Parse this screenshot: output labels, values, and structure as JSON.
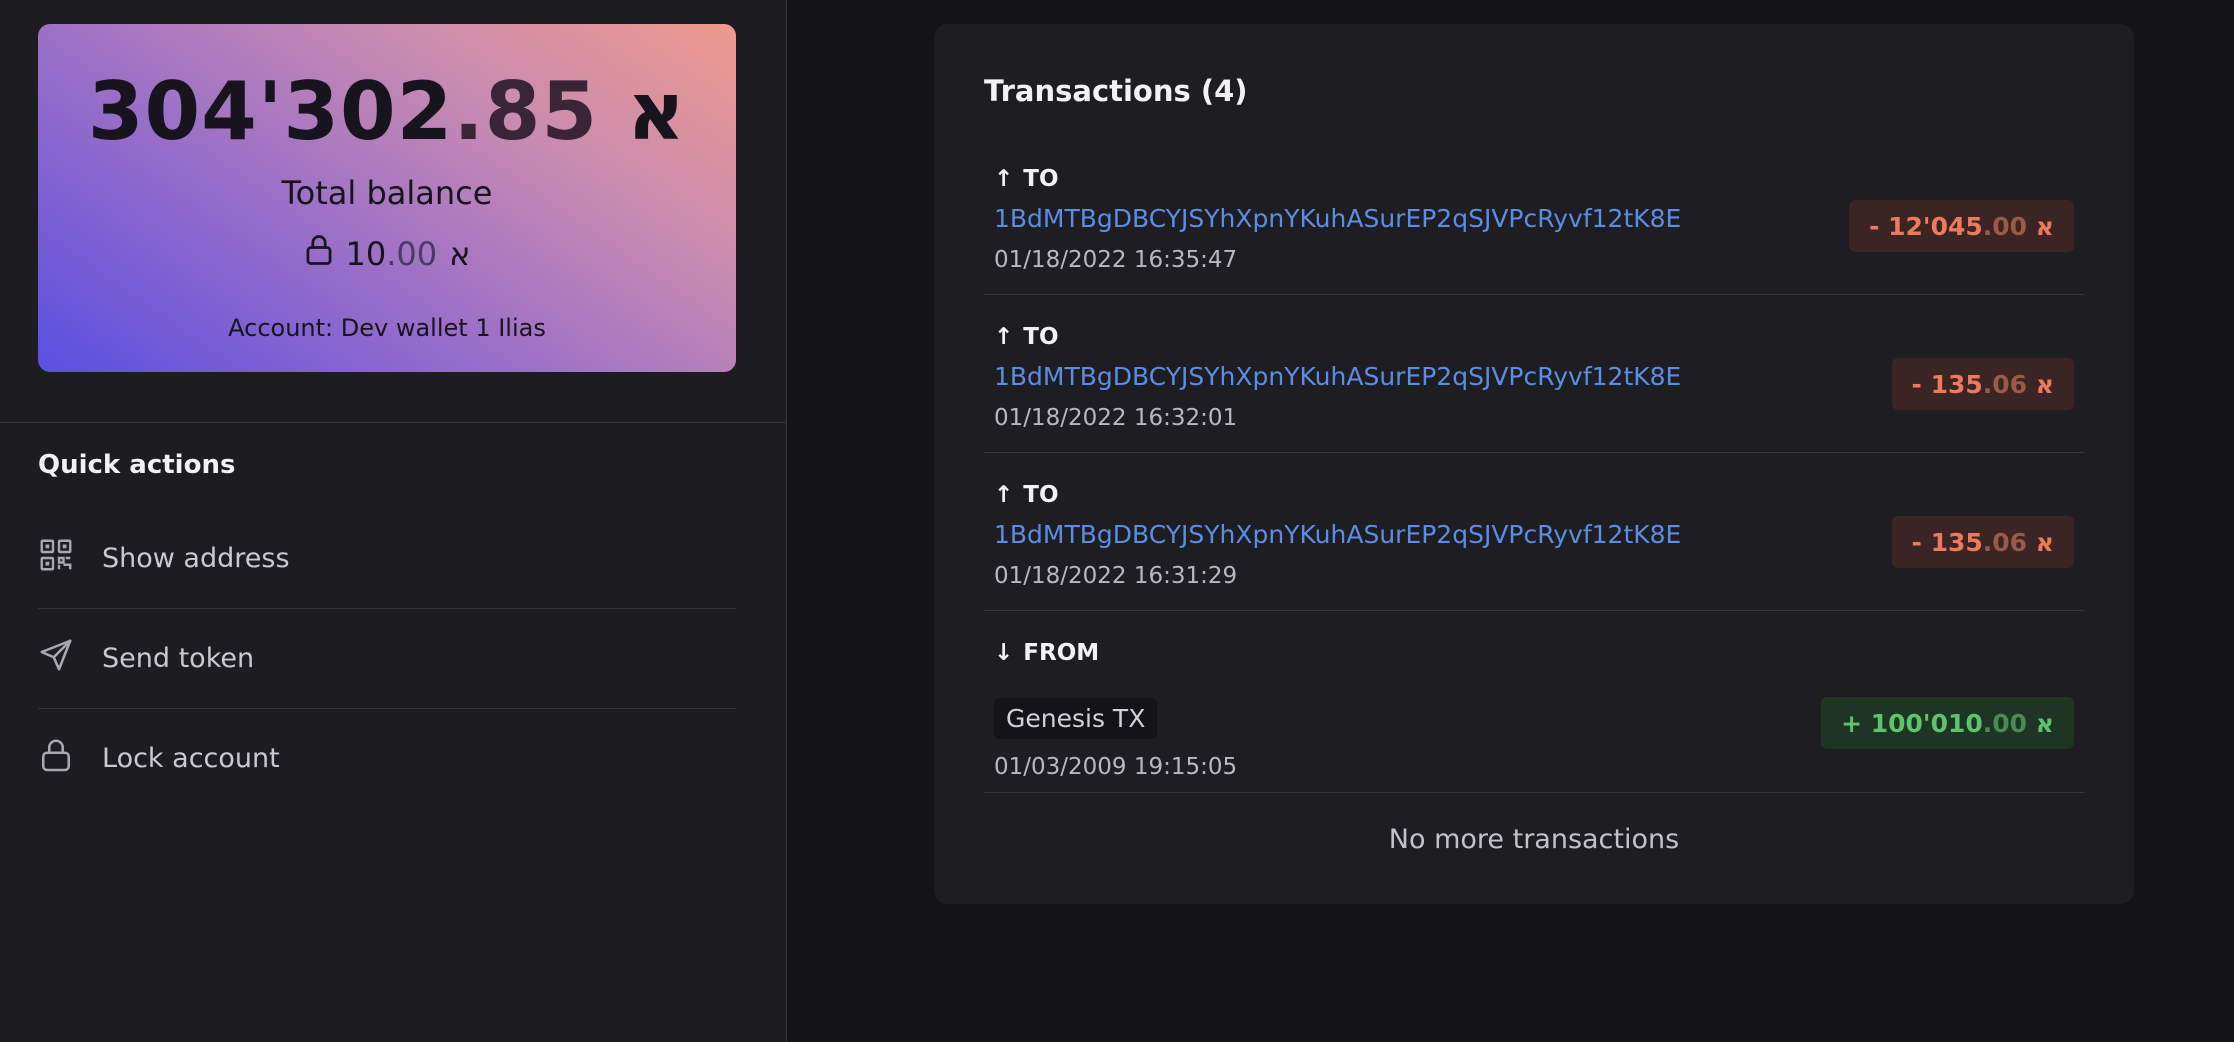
{
  "balance": {
    "amount_int": "304'302",
    "amount_dec": ".85",
    "currency_symbol": "א",
    "caption": "Total balance",
    "locked_int": "10",
    "locked_dec": ".00",
    "account_label": "Account: Dev wallet 1 Ilias"
  },
  "quick_actions": {
    "title": "Quick actions",
    "items": [
      {
        "label": "Show address",
        "icon": "qr-code-icon"
      },
      {
        "label": "Send token",
        "icon": "send-icon"
      },
      {
        "label": "Lock account",
        "icon": "lock-icon"
      }
    ]
  },
  "transactions": {
    "title": "Transactions (4)",
    "items": [
      {
        "direction": "TO",
        "arrow": "↑",
        "address": "1BdMTBgDBCYJSYhXpnYKuhASurEP2qSJVPcRyvf12tK8E",
        "date": "01/18/2022 16:35:47",
        "amount_int": "- 12'045",
        "amount_dec": ".00",
        "currency": "א"
      },
      {
        "direction": "TO",
        "arrow": "↑",
        "address": "1BdMTBgDBCYJSYhXpnYKuhASurEP2qSJVPcRyvf12tK8E",
        "date": "01/18/2022 16:32:01",
        "amount_int": "- 135",
        "amount_dec": ".06",
        "currency": "א"
      },
      {
        "direction": "TO",
        "arrow": "↑",
        "address": "1BdMTBgDBCYJSYhXpnYKuhASurEP2qSJVPcRyvf12tK8E",
        "date": "01/18/2022 16:31:29",
        "amount_int": "- 135",
        "amount_dec": ".06",
        "currency": "א"
      },
      {
        "direction": "FROM",
        "arrow": "↓",
        "source": "Genesis TX",
        "date": "01/03/2009 19:15:05",
        "amount_int": "+ 100'010",
        "amount_dec": ".00",
        "currency": "א"
      }
    ],
    "footer": "No more transactions"
  },
  "colors": {
    "address_link": "#5b8de4",
    "negative_amount": "#ee7a5c",
    "positive_amount": "#5cc46c"
  }
}
